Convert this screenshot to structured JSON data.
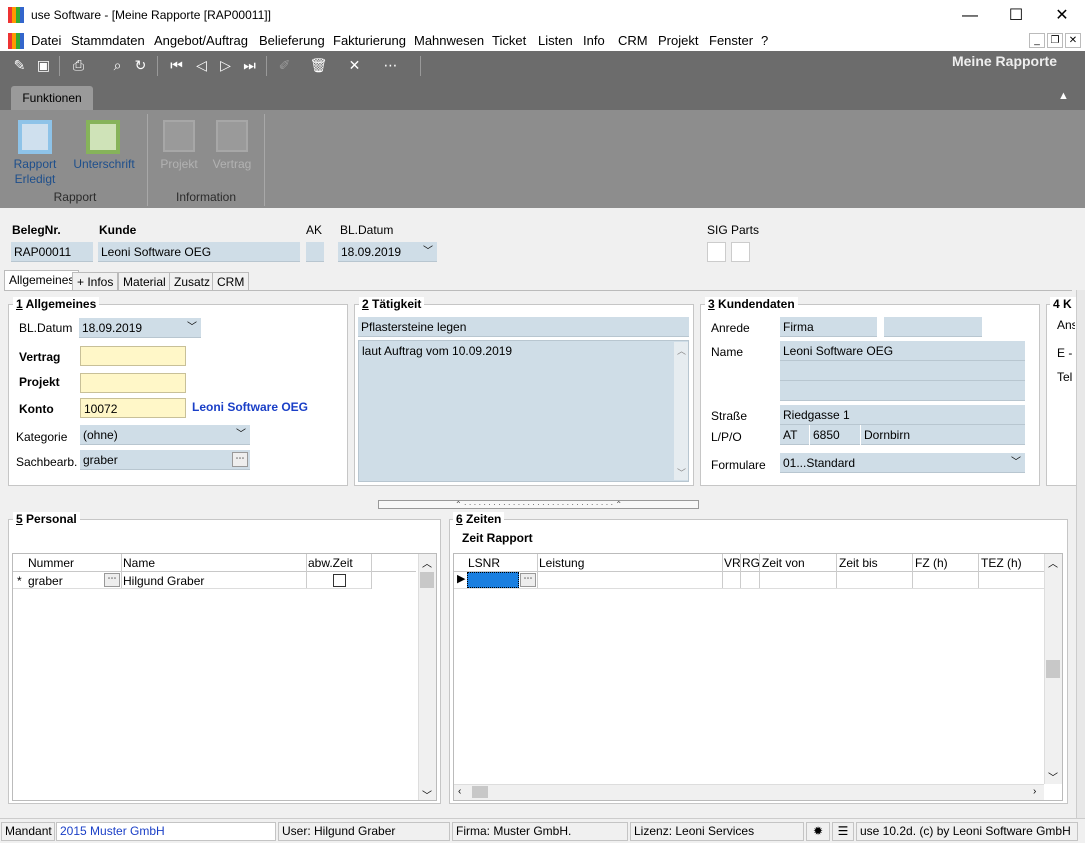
{
  "window": {
    "title": "use Software - [Meine Rapporte [RAP00011]]",
    "minimize": "—",
    "maximize": "☐",
    "close": "✕"
  },
  "menu": {
    "items": [
      "Datei",
      "Stammdaten",
      "Angebot/Auftrag",
      "Belieferung",
      "Fakturierung",
      "Mahnwesen",
      "Ticket",
      "Listen",
      "Info",
      "CRM",
      "Projekt",
      "Fenster",
      "?"
    ],
    "mdi_min": "_",
    "mdi_restore": "❐",
    "mdi_close": "✕"
  },
  "toolbar": {
    "title": "Meine Rapporte"
  },
  "ribbon": {
    "tab": "Funktionen",
    "buttons": {
      "rapport_erledigt": "Rapport Erledigt",
      "unterschrift": "Unterschrift",
      "projekt": "Projekt",
      "vertrag": "Vertrag"
    },
    "groups": {
      "rapport": "Rapport",
      "information": "Information"
    }
  },
  "header": {
    "belegnr_label": "BelegNr.",
    "belegnr": "RAP00011",
    "kunde_label": "Kunde",
    "kunde": "Leoni Software OEG",
    "ak_label": "AK",
    "ak": "",
    "bldatum_label": "BL.Datum",
    "bldatum": "18.09.2019",
    "sig_label": "SIG",
    "parts_label": "Parts"
  },
  "tabs": [
    "Allgemeines",
    "+ Infos",
    "Material",
    "Zusatz",
    "CRM"
  ],
  "allgemeines": {
    "num": "1",
    "title": " Allgemeines",
    "bldatum_label": "BL.Datum",
    "bldatum": "18.09.2019",
    "vertrag_label": "Vertrag",
    "vertrag": "",
    "projekt_label": "Projekt",
    "projekt": "",
    "konto_label": "Konto",
    "konto": "10072",
    "konto_name": "Leoni Software OEG",
    "kategorie_label": "Kategorie",
    "kategorie": "(ohne)",
    "sachbearb_label": "Sachbearb.",
    "sachbearb": "graber"
  },
  "taetigkeit": {
    "num": "2",
    "title": " Tätigkeit",
    "summary": "Pflastersteine legen",
    "text": "laut Auftrag vom 10.09.2019"
  },
  "kundendaten": {
    "num": "3",
    "title": " Kundendaten",
    "anrede_label": "Anrede",
    "anrede": "Firma",
    "name_label": "Name",
    "name": "Leoni Software OEG",
    "strasse_label": "Straße",
    "strasse": "Riedgasse 1",
    "lpo_label": "L/P/O",
    "land": "AT",
    "plz": "6850",
    "ort": "Dornbirn",
    "formulare_label": "Formulare",
    "formulare": "01...Standard"
  },
  "panel4": {
    "title": "4 K",
    "l1": "Ans",
    "l2": "E -",
    "l3": "Tel"
  },
  "personal": {
    "num": "5",
    "title": " Personal",
    "columns": [
      "Nummer",
      "Name",
      "abw.Zeit"
    ],
    "rows": [
      {
        "marker": "*",
        "nummer": "graber",
        "name": "Hilgund Graber",
        "abw": false
      }
    ]
  },
  "zeiten": {
    "num": "6",
    "title": " Zeiten",
    "subtitle": "Zeit Rapport",
    "columns": [
      "LSNR",
      "Leistung",
      "VR",
      "RG",
      "Zeit von",
      "Zeit bis",
      "FZ (h)",
      "TEZ (h)"
    ]
  },
  "statusbar": {
    "mandant_label": "Mandant",
    "mandant": "2015 Muster GmbH",
    "user": "User: Hilgund Graber",
    "firma": "Firma: Muster GmbH.",
    "lizenz": "Lizenz: Leoni Services",
    "version": "use 10.2d. (c) by Leoni Software GmbH"
  }
}
